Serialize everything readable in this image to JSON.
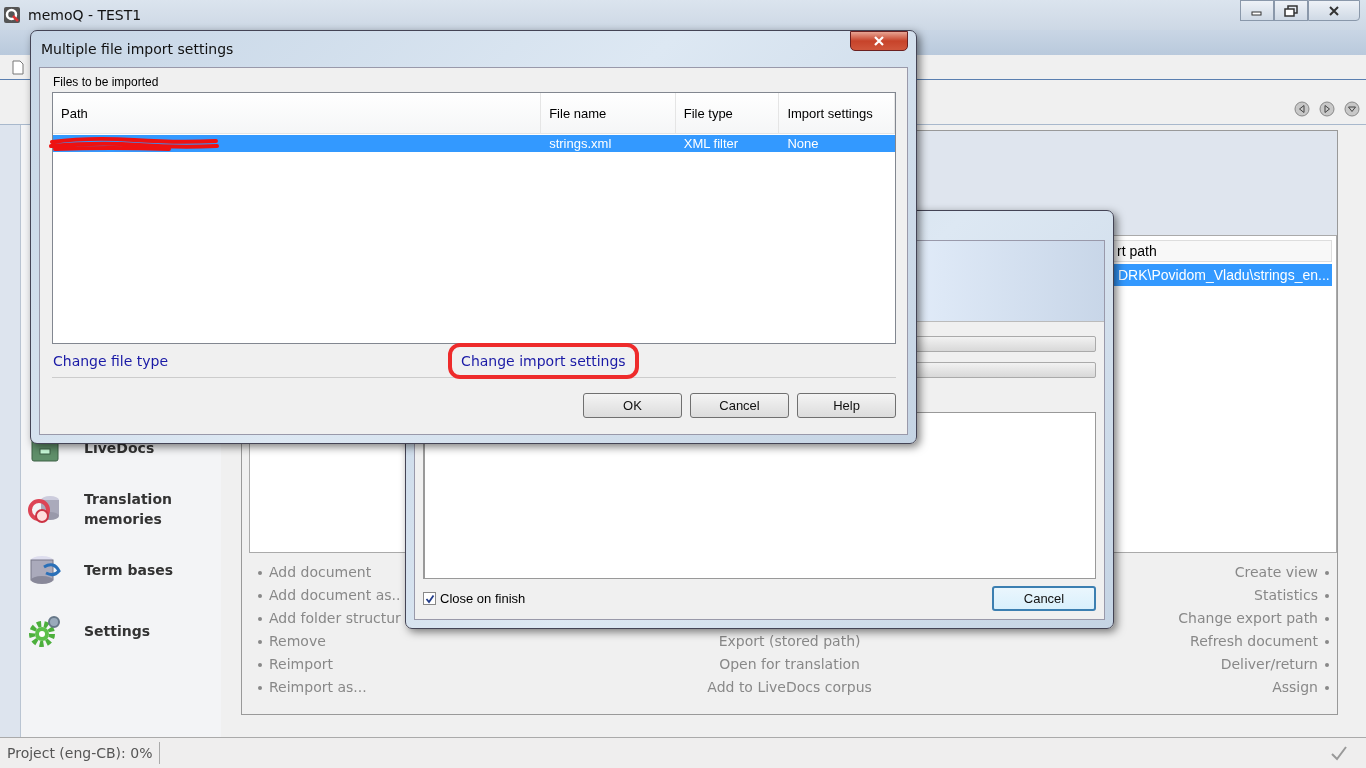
{
  "window": {
    "title": "memoQ - TEST1"
  },
  "sidebar": {
    "items": [
      {
        "label": "LiveDocs"
      },
      {
        "label": "Translation memories"
      },
      {
        "label": "Term bases"
      },
      {
        "label": "Settings"
      }
    ]
  },
  "documents": {
    "columns": [
      "rt path"
    ],
    "rows": [
      {
        "cells": [
          "DRK\\Povidom_Vladu\\strings_en..."
        ],
        "selected": true
      }
    ]
  },
  "actions": {
    "left": [
      "Add document",
      "Add document as..",
      "Add folder structur",
      "Remove",
      "Reimport",
      "Reimport as..."
    ],
    "center": [
      "Export (stored path)",
      "Open for translation",
      "Add to LiveDocs corpus"
    ],
    "right": [
      "Create view",
      "Statistics",
      "Change export path",
      "Refresh document",
      "Deliver/return",
      "Assign"
    ]
  },
  "status_bar": {
    "text": "Project (eng-CB): 0%"
  },
  "progress_dialog": {
    "progress": [
      {
        "level": 0
      },
      {
        "level": 0
      }
    ],
    "close_on_finish": {
      "label": "Close on finish",
      "checked": true
    },
    "cancel": "Cancel"
  },
  "import_dialog": {
    "title": "Multiple file import settings",
    "group": "Files to be imported",
    "columns": [
      "Path",
      "File name",
      "File type",
      "Import settings"
    ],
    "rows": [
      {
        "path_redacted": true,
        "file_name": "strings.xml",
        "file_type": "XML filter",
        "import_settings": "None",
        "selected": true
      }
    ],
    "links": [
      {
        "label": "Change file type",
        "circled": false
      },
      {
        "label": "Change import settings",
        "circled": true
      }
    ],
    "buttons": [
      "OK",
      "Cancel",
      "Help"
    ]
  }
}
